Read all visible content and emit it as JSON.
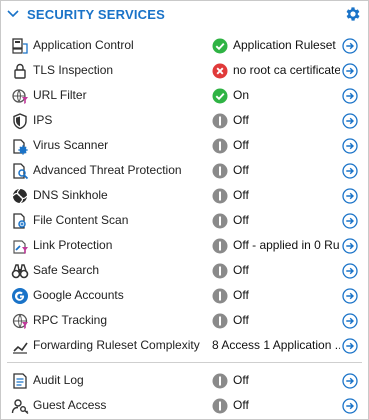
{
  "header": {
    "title": "SECURITY SERVICES",
    "accent": "#1a73c8",
    "collapse_icon": "chevron-down-icon",
    "settings_icon": "gear-icon"
  },
  "colors": {
    "status_on": "#2fb344",
    "status_error": "#e03a3a",
    "status_off": "#8a8a8a",
    "link": "#1a73c8"
  },
  "services": [
    {
      "key": "application-control",
      "label": "Application Control",
      "icon": "application-control-icon",
      "state": "on",
      "status": "Application Ruleset"
    },
    {
      "key": "tls-inspection",
      "label": "TLS Inspection",
      "icon": "lock-icon",
      "state": "error",
      "status": "no root ca certificate..."
    },
    {
      "key": "url-filter",
      "label": "URL Filter",
      "icon": "globe-filter-icon",
      "state": "on",
      "status": "On"
    },
    {
      "key": "ips",
      "label": "IPS",
      "icon": "shield-icon",
      "state": "off",
      "status": "Off"
    },
    {
      "key": "virus-scanner",
      "label": "Virus Scanner",
      "icon": "virus-scanner-icon",
      "state": "off",
      "status": "Off"
    },
    {
      "key": "advanced-threat-protection",
      "label": "Advanced Threat Protection",
      "icon": "document-search-icon",
      "state": "off",
      "status": "Off"
    },
    {
      "key": "dns-sinkhole",
      "label": "DNS Sinkhole",
      "icon": "sinkhole-icon",
      "state": "off",
      "status": "Off"
    },
    {
      "key": "file-content-scan",
      "label": "File Content Scan",
      "icon": "file-scan-icon",
      "state": "off",
      "status": "Off"
    },
    {
      "key": "link-protection",
      "label": "Link Protection",
      "icon": "link-protection-icon",
      "state": "off",
      "status": "Off - applied in 0 Rul..."
    },
    {
      "key": "safe-search",
      "label": "Safe Search",
      "icon": "binoculars-icon",
      "state": "off",
      "status": "Off"
    },
    {
      "key": "google-accounts",
      "label": "Google Accounts",
      "icon": "google-icon",
      "state": "off",
      "status": "Off"
    },
    {
      "key": "rpc-tracking",
      "label": "RPC Tracking",
      "icon": "rpc-icon",
      "state": "off",
      "status": "Off"
    },
    {
      "key": "forwarding-ruleset-complexity",
      "label": "Forwarding Ruleset Complexity",
      "icon": "ruleset-icon",
      "state": "none",
      "status": "8 Access 1 Application ..."
    }
  ],
  "extras": [
    {
      "key": "audit-log",
      "label": "Audit Log",
      "icon": "audit-log-icon",
      "state": "off",
      "status": "Off"
    },
    {
      "key": "guest-access",
      "label": "Guest Access",
      "icon": "guest-access-icon",
      "state": "off",
      "status": "Off"
    }
  ]
}
